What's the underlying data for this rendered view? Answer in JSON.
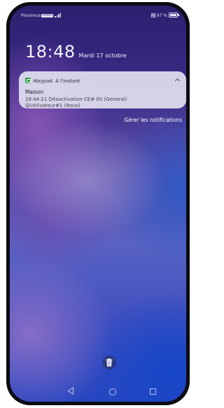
{
  "status_bar": {
    "carrier": "Proximus",
    "wifi_calling_badge": "VoWiFi",
    "signal_icon": "signal-strength-icon",
    "nfc_icon": "nfc-icon",
    "battery_level": "97 %"
  },
  "lock_screen": {
    "time": "18:48",
    "date": "Mardi 17 octobre"
  },
  "notification": {
    "app_name": "iKeypad",
    "timestamp": "À l'instant",
    "title": "Maison",
    "body_line1": "18:44:21 Désactivation CE# 00 (General)",
    "body_line2": "@Utilisateur#1 (Nous)",
    "app_icon_color": "#27a03a"
  },
  "manage_notifications_label": "Gérer les notifications",
  "clear_icon": "trash-icon",
  "navigation": {
    "back_icon": "back-triangle-icon",
    "home_icon": "home-circle-icon",
    "recents_icon": "recents-square-icon"
  }
}
